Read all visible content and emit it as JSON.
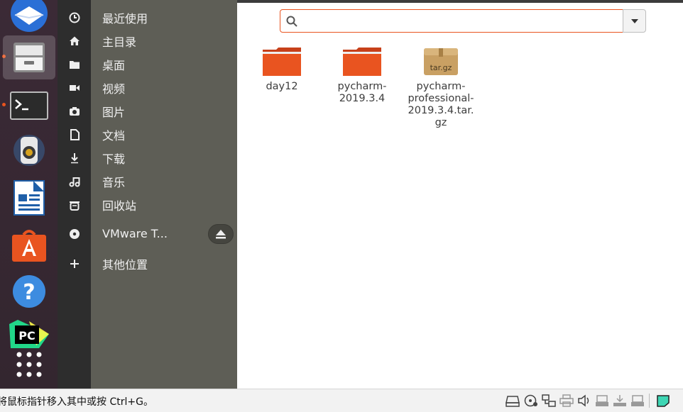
{
  "dock": {
    "items": [
      {
        "name": "thunderbird-icon"
      },
      {
        "name": "files-icon"
      },
      {
        "name": "terminal-icon"
      },
      {
        "name": "rhythmbox-icon"
      },
      {
        "name": "libreoffice-writer-icon"
      },
      {
        "name": "software-center-icon"
      },
      {
        "name": "help-icon"
      },
      {
        "name": "pycharm-icon",
        "text": "PC"
      },
      {
        "name": "app-grid-icon"
      }
    ]
  },
  "sidebar": {
    "items": [
      {
        "label": "最近使用",
        "icon": "clock-icon"
      },
      {
        "label": "主目录",
        "icon": "home-icon"
      },
      {
        "label": "桌面",
        "icon": "desktop-folder-icon"
      },
      {
        "label": "视频",
        "icon": "video-icon"
      },
      {
        "label": "图片",
        "icon": "camera-icon"
      },
      {
        "label": "文档",
        "icon": "document-icon"
      },
      {
        "label": "下载",
        "icon": "download-icon"
      },
      {
        "label": "音乐",
        "icon": "music-icon"
      },
      {
        "label": "回收站",
        "icon": "trash-icon"
      }
    ],
    "devices": [
      {
        "label": "VMware T...",
        "icon": "disc-icon"
      }
    ],
    "other": {
      "label": "其他位置",
      "icon": "plus-icon"
    }
  },
  "search": {
    "value": "",
    "placeholder": ""
  },
  "files": [
    {
      "label": "day12",
      "type": "folder"
    },
    {
      "label": "pycharm-2019.3.4",
      "type": "folder"
    },
    {
      "label": "pycharm-professional-2019.3.4.tar.gz",
      "type": "archive",
      "badge": "tar.gz"
    }
  ],
  "status": {
    "text": "将鼠标指针移入其中或按 Ctrl+G。"
  },
  "colors": {
    "accent": "#e95420",
    "folder": "#e95420",
    "dock_bg": "#3b2a36",
    "sidebar_bg": "#5e5e56"
  }
}
